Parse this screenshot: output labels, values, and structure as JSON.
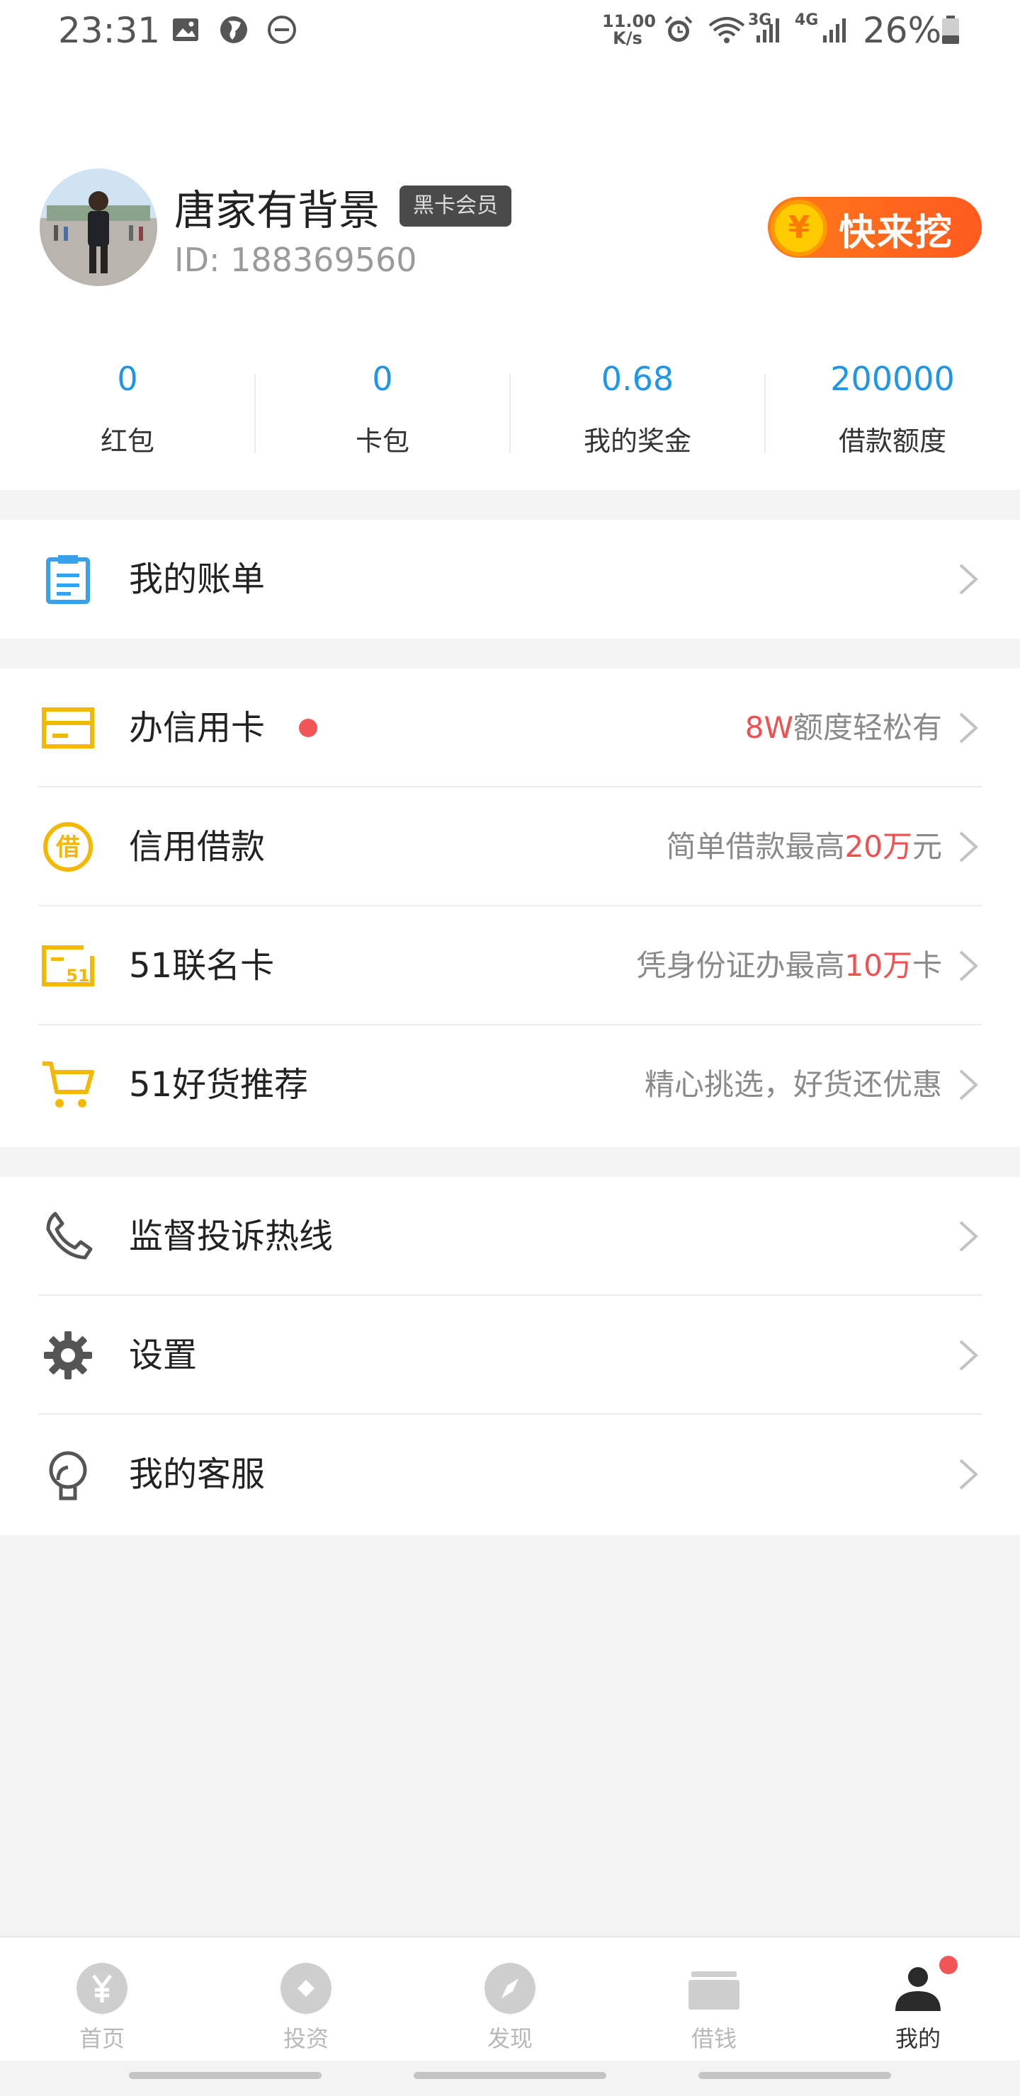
{
  "status_bar": {
    "time": "23:31",
    "speed_value": "11.00",
    "speed_unit": "K/s",
    "network_a": "3G",
    "network_b": "4G",
    "battery": "26%",
    "icons": [
      "image-icon",
      "globe-icon",
      "dnd-icon",
      "alarm-icon",
      "wifi-icon",
      "signal-icon",
      "battery-icon"
    ]
  },
  "profile": {
    "name": "唐家有背景",
    "badge": "黑卡会员",
    "id": "ID: 188369560",
    "promo_coin": "¥",
    "promo_text": "快来挖"
  },
  "stats": [
    {
      "value": "0",
      "label": "红包"
    },
    {
      "value": "0",
      "label": "卡包"
    },
    {
      "value": "0.68",
      "label": "我的奖金"
    },
    {
      "value": "200000",
      "label": "借款额度"
    }
  ],
  "menu": {
    "bill": {
      "label": "我的账单"
    },
    "credit_card": {
      "label": "办信用卡",
      "right_hl": "8W",
      "right_rest": "额度轻松有"
    },
    "loan": {
      "label": "信用借款",
      "right_pre": "简单借款最高",
      "right_hl": "20万",
      "right_post": "元",
      "icon_text": "借"
    },
    "cobrand": {
      "label": "51联名卡",
      "right_pre": "凭身份证办最高",
      "right_hl": "10万",
      "right_post": "卡",
      "icon_text": "51"
    },
    "goods": {
      "label": "51好货推荐",
      "right": "精心挑选，好货还优惠"
    },
    "complaint": {
      "label": "监督投诉热线"
    },
    "settings": {
      "label": "设置"
    },
    "service": {
      "label": "我的客服"
    }
  },
  "colors": {
    "accent_blue": "#2196e6",
    "accent_yellow": "#f5b800",
    "highlight_red": "#f05050",
    "promo_orange": "#ff6a1a"
  },
  "bottom_nav": [
    {
      "label": "首页",
      "icon": "yen-icon"
    },
    {
      "label": "投资",
      "icon": "diamond-icon"
    },
    {
      "label": "发现",
      "icon": "compass-icon"
    },
    {
      "label": "借钱",
      "icon": "wallet-icon"
    },
    {
      "label": "我的",
      "icon": "person-icon",
      "active": true
    }
  ]
}
